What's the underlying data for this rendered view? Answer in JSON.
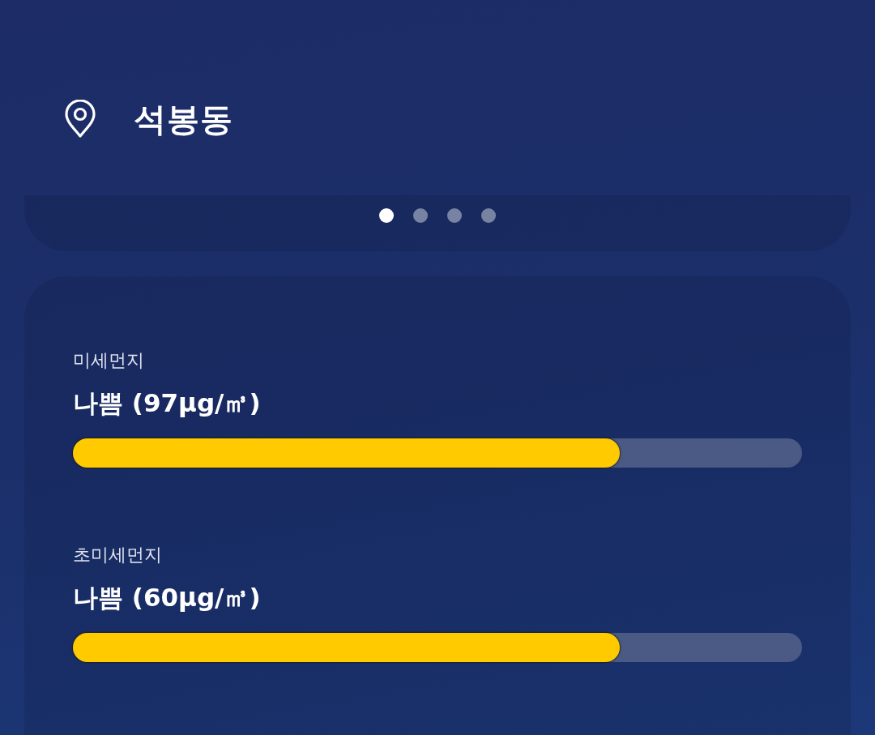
{
  "location": {
    "name": "석봉동"
  },
  "pages": [
    {
      "selected": true
    },
    {
      "selected": false
    },
    {
      "selected": false
    },
    {
      "selected": false
    }
  ],
  "measurements": [
    {
      "label": "미세먼지",
      "reading": "나쁨 (97μg/㎥)",
      "level": 0.75
    },
    {
      "label": "초미세먼지",
      "reading": "나쁨 (60μg/㎥)",
      "level": 0.75
    }
  ]
}
